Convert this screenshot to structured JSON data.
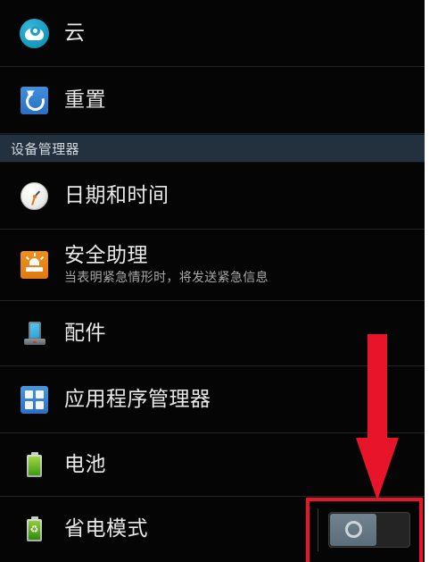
{
  "screen": {
    "title": "Android Settings — Device Manager",
    "background_color": "#050505",
    "accent_color": "#e8152a"
  },
  "list": {
    "items": [
      {
        "id": "cloud",
        "label": "云",
        "subtitle": "",
        "icon": "cloud-icon",
        "has_toggle": false
      },
      {
        "id": "reset",
        "label": "重置",
        "subtitle": "",
        "icon": "reset-icon",
        "has_toggle": false
      }
    ]
  },
  "section": {
    "header_label": "设备管理器",
    "header_background": "#23303d",
    "items": [
      {
        "id": "date-time",
        "label": "日期和时间",
        "subtitle": "",
        "icon": "clock-icon",
        "has_toggle": false
      },
      {
        "id": "safety-assistance",
        "label": "安全助理",
        "subtitle": "当表明紧急情形时，将发送紧急信息",
        "icon": "emergency-siren-icon",
        "has_toggle": false
      },
      {
        "id": "accessory",
        "label": "配件",
        "subtitle": "",
        "icon": "phone-dock-icon",
        "has_toggle": false
      },
      {
        "id": "application-manager",
        "label": "应用程序管理器",
        "subtitle": "",
        "icon": "app-grid-icon",
        "has_toggle": false
      },
      {
        "id": "battery",
        "label": "电池",
        "subtitle": "",
        "icon": "battery-icon",
        "has_toggle": false
      },
      {
        "id": "power-saving-mode",
        "label": "省电模式",
        "subtitle": "",
        "icon": "battery-eco-icon",
        "has_toggle": true,
        "toggle_state": "off"
      }
    ]
  },
  "annotation": {
    "arrow": {
      "name": "red-down-arrow",
      "color": "#e8152a",
      "direction": "down",
      "points_to": "power-saving-mode-toggle"
    },
    "highlight_box": {
      "name": "red-highlight-box",
      "color": "#e8152a",
      "surrounds": "power-saving-mode-toggle"
    }
  }
}
